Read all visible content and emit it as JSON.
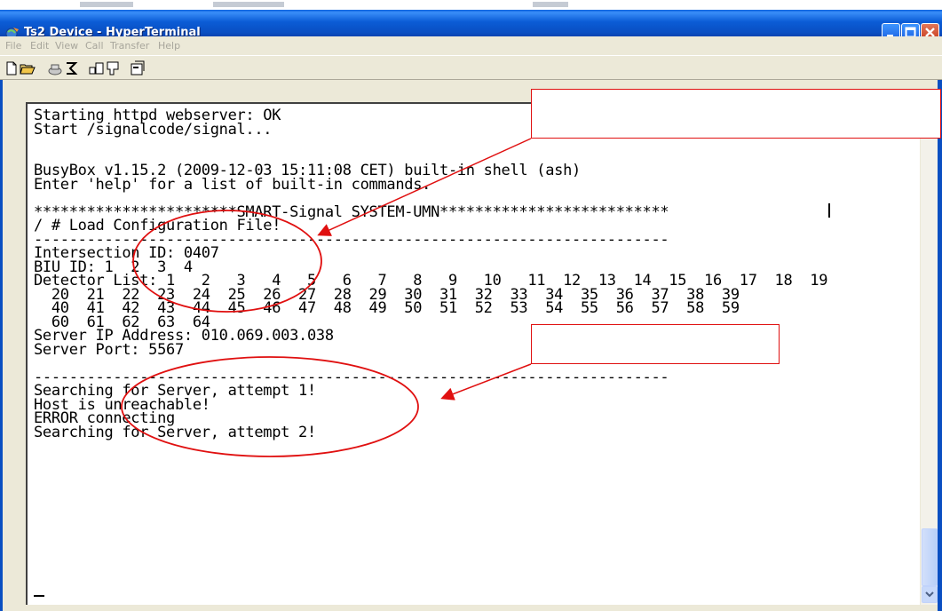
{
  "window": {
    "title": "Ts2 Device - HyperTerminal"
  },
  "menu": [
    "File",
    "Edit",
    "View",
    "Call",
    "Transfer",
    "Help"
  ],
  "toolbar_icons": [
    "new-icon",
    "open-icon",
    "call-icon",
    "disconnect-icon",
    "send-icon",
    "receive-icon",
    "properties-icon"
  ],
  "terminal": {
    "lines": [
      "Starting httpd webserver: OK",
      "Start /signalcode/signal...",
      "",
      "",
      "BusyBox v1.15.2 (2009-12-03 15:11:08 CET) built-in shell (ash)",
      "Enter 'help' for a list of built-in commands.",
      "",
      "***********************SMART-Signal SYSTEM-UMN**************************",
      "/ # Load Configuration File!",
      "------------------------------------------------------------------------",
      "Intersection ID: 0407",
      "BIU ID: 1  2  3  4",
      "Detector List: 1   2   3   4   5   6   7   8   9   10   11  12  13  14  15  16  17  18  19",
      "  20  21  22  23  24  25  26  27  28  29  30  31  32  33  34  35  36  37  38  39",
      "  40  41  42  43  44  45  46  47  48  49  50  51  52  53  54  55  56  57  58  59",
      "  60  61  62  63  64",
      "Server IP Address: 010.069.003.038",
      "Server Port: 5567",
      "",
      "------------------------------------------------------------------------",
      "Searching for Server, attempt 1!",
      "Host is unreachable!",
      "ERROR connecting",
      "Searching for Server, attempt 2!"
    ]
  },
  "colors": {
    "titlebar": "#0a5fdc",
    "annotation": "#e01010"
  }
}
